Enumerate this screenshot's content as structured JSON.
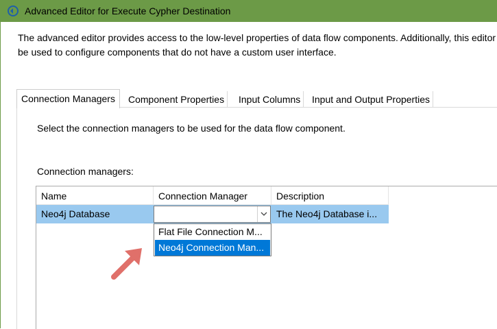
{
  "window": {
    "title": "Advanced Editor for Execute Cypher Destination",
    "icon": "ssis-component-icon"
  },
  "description": {
    "line1": "The advanced editor provides access to the low-level properties of data flow components. Additionally, this editor can",
    "line2": "be used to configure components that do not have a custom user interface."
  },
  "tabs": [
    {
      "label": "Connection Managers",
      "active": true
    },
    {
      "label": "Component Properties",
      "active": false
    },
    {
      "label": "Input Columns",
      "active": false
    },
    {
      "label": "Input and Output Properties",
      "active": false
    }
  ],
  "panel": {
    "instruction": "Select the connection managers to be used for the data flow component.",
    "list_label": "Connection managers:"
  },
  "grid": {
    "columns": [
      "Name",
      "Connection Manager",
      "Description"
    ],
    "rows": [
      {
        "name": "Neo4j Database",
        "connection_manager": "",
        "description": "The Neo4j Database i..."
      }
    ]
  },
  "dropdown": {
    "options": [
      "Flat File Connection M...",
      "Neo4j Connection Man..."
    ],
    "selected_index": 1
  },
  "annotation": {
    "arrow_color": "#e0706a"
  }
}
